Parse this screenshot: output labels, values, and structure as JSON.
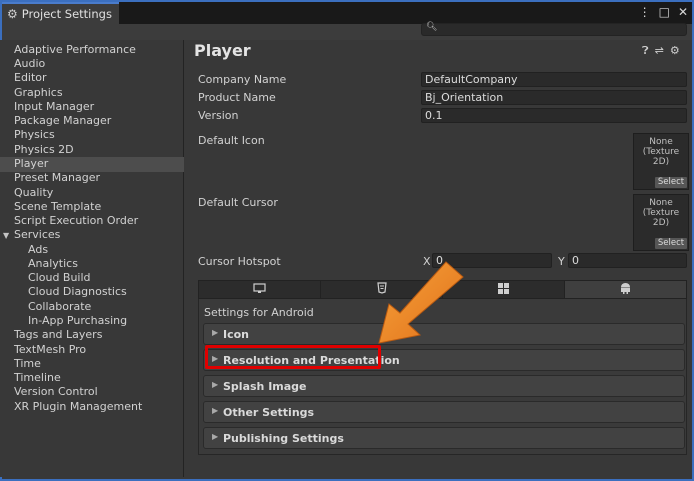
{
  "window": {
    "tab_title": "Project Settings",
    "controls": [
      "⋮",
      "□",
      "✕"
    ]
  },
  "search": {
    "placeholder": ""
  },
  "sidebar": {
    "items": [
      {
        "label": "Adaptive Performance"
      },
      {
        "label": "Audio"
      },
      {
        "label": "Editor"
      },
      {
        "label": "Graphics"
      },
      {
        "label": "Input Manager"
      },
      {
        "label": "Package Manager"
      },
      {
        "label": "Physics"
      },
      {
        "label": "Physics 2D"
      },
      {
        "label": "Player",
        "selected": true
      },
      {
        "label": "Preset Manager"
      },
      {
        "label": "Quality"
      },
      {
        "label": "Scene Template"
      },
      {
        "label": "Script Execution Order"
      },
      {
        "label": "Services",
        "expanded": true
      },
      {
        "label": "Ads",
        "sub": true
      },
      {
        "label": "Analytics",
        "sub": true
      },
      {
        "label": "Cloud Build",
        "sub": true
      },
      {
        "label": "Cloud Diagnostics",
        "sub": true
      },
      {
        "label": "Collaborate",
        "sub": true
      },
      {
        "label": "In-App Purchasing",
        "sub": true
      },
      {
        "label": "Tags and Layers"
      },
      {
        "label": "TextMesh Pro"
      },
      {
        "label": "Time"
      },
      {
        "label": "Timeline"
      },
      {
        "label": "Version Control"
      },
      {
        "label": "XR Plugin Management"
      }
    ]
  },
  "main": {
    "title": "Player",
    "header_icons": [
      "help-icon",
      "preset-icon",
      "settings-icon"
    ],
    "company_name_label": "Company Name",
    "company_name_value": "DefaultCompany",
    "product_name_label": "Product Name",
    "product_name_value": "Bj_Orientation",
    "version_label": "Version",
    "version_value": "0.1",
    "default_icon_label": "Default Icon",
    "default_cursor_label": "Default Cursor",
    "texture_none_line1": "None",
    "texture_none_line2": "(Texture 2D)",
    "select_label": "Select",
    "cursor_hotspot_label": "Cursor Hotspot",
    "hotspot_x_label": "X",
    "hotspot_x_value": "0",
    "hotspot_y_label": "Y",
    "hotspot_y_value": "0",
    "platform_tabs": [
      {
        "icon": "monitor-icon",
        "glyph": "🖵"
      },
      {
        "icon": "html5-icon",
        "glyph": "⬡"
      },
      {
        "icon": "windows-icon",
        "glyph": "⊞"
      },
      {
        "icon": "android-icon",
        "glyph": "◉",
        "active": true
      }
    ],
    "settings_for": "Settings for Android",
    "sections": [
      "Icon",
      "Resolution and Presentation",
      "Splash Image",
      "Other Settings",
      "Publishing Settings"
    ],
    "highlighted_section": "Resolution and Presentation"
  },
  "colors": {
    "highlight": "#e00000",
    "arrow": "#f08c1e",
    "window_border": "#3b6fbf"
  }
}
